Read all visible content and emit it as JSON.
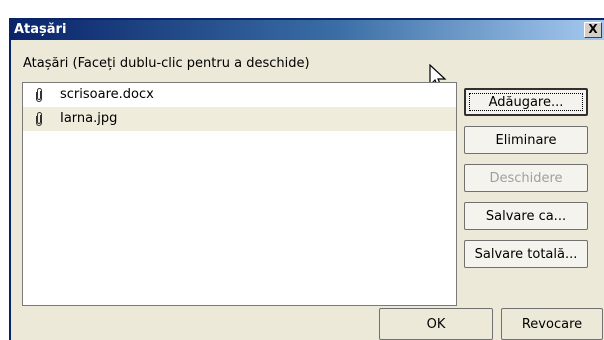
{
  "dialog": {
    "title": "Atașări",
    "close_label": "X",
    "instructions": "Atașări (Faceți dublu-clic pentru a deschide)"
  },
  "files": [
    {
      "name": "scrisoare.docx",
      "icon": "paperclip-icon"
    },
    {
      "name": "Iarna.jpg",
      "icon": "paperclip-icon",
      "selected": true
    }
  ],
  "buttons": {
    "add": "Adăugare...",
    "remove": "Eliminare",
    "open": "Deschidere",
    "save_as": "Salvare ca...",
    "save_all": "Salvare totală...",
    "ok": "OK",
    "cancel": "Revocare"
  },
  "colors": {
    "titlebar_start": "#0a246a",
    "titlebar_end": "#a6caf0",
    "dialog_bg": "#ece9d8",
    "selected_row": "#f0ecdc"
  }
}
